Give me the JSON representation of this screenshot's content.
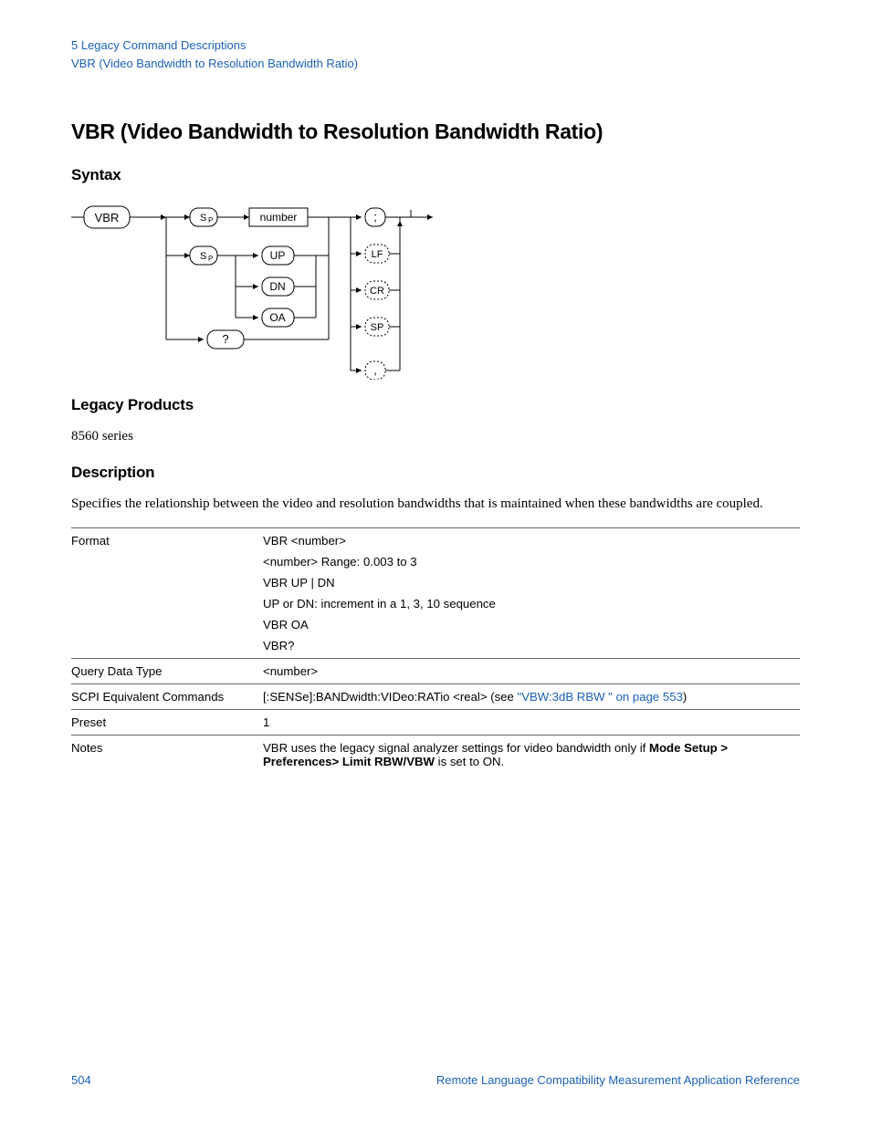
{
  "header": {
    "chapter": "5  Legacy Command Descriptions",
    "section": "VBR (Video Bandwidth to Resolution Bandwidth Ratio)"
  },
  "title": "VBR (Video Bandwidth to Resolution Bandwidth Ratio)",
  "sections": {
    "syntax": "Syntax",
    "legacy_products": "Legacy Products",
    "description": "Description"
  },
  "legacy_products_body": "8560 series",
  "description_body": "Specifies the relationship between the video and resolution bandwidths that is maintained when these bandwidths are coupled.",
  "diagram": {
    "start": "VBR",
    "sp1": "S",
    "sp1_sub": "P",
    "number": "number",
    "sp2": "S",
    "sp2_sub": "P",
    "up": "UP",
    "dn": "DN",
    "oa": "OA",
    "q": "?",
    "semi": ";",
    "lf": "LF",
    "cr": "CR",
    "spterm": "SP",
    "comma": ","
  },
  "table": {
    "rows": [
      {
        "label": "Format",
        "lines": [
          "VBR <number>",
          "<number> Range: 0.003 to 3",
          "VBR UP | DN",
          "UP or DN: increment in a 1, 3, 10 sequence",
          "VBR OA",
          "VBR?"
        ]
      },
      {
        "label": "Query Data Type",
        "lines": [
          "<number>"
        ]
      },
      {
        "label": "SCPI Equivalent Commands",
        "scpi_prefix": "[:SENSe]:BANDwidth:VIDeo:RATio <real> (see ",
        "scpi_link": "\"VBW:3dB RBW \" on page 553",
        "scpi_suffix": ")"
      },
      {
        "label": "Preset",
        "lines": [
          "1"
        ]
      },
      {
        "label": "Notes",
        "notes_prefix": "VBR uses the legacy signal analyzer settings for video bandwidth only if ",
        "notes_bold": "Mode Setup > Preferences> Limit RBW/VBW",
        "notes_suffix": " is set to ON."
      }
    ]
  },
  "footer": {
    "page": "504",
    "ref": "Remote Language Compatibility Measurement Application Reference"
  }
}
